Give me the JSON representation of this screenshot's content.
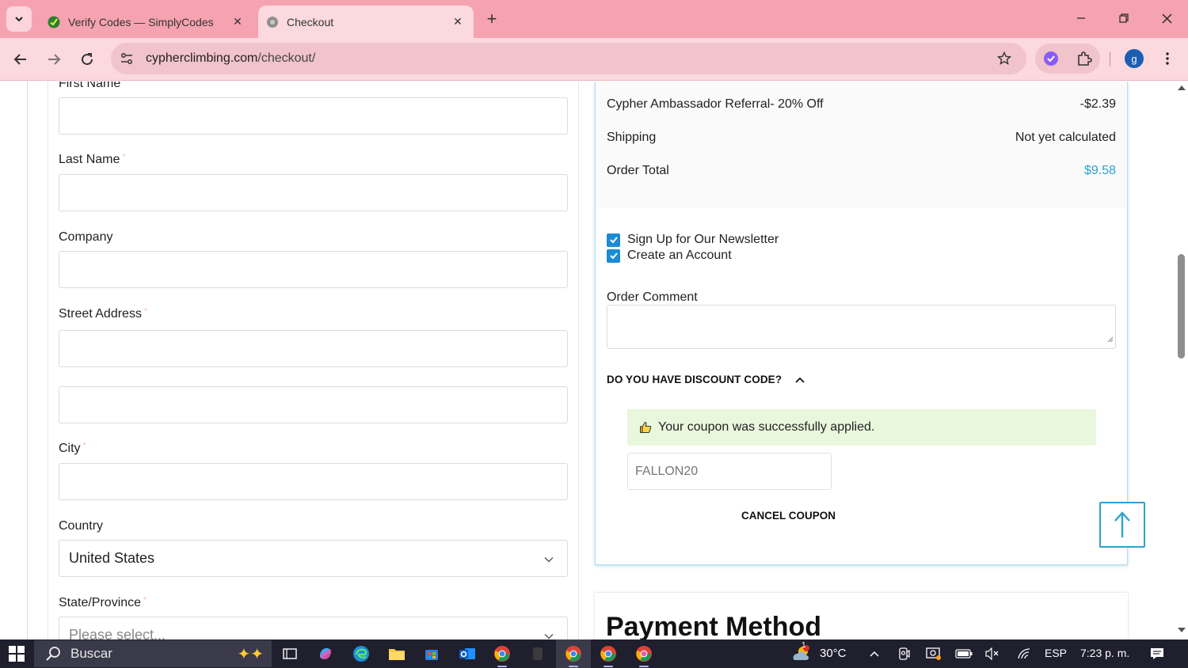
{
  "browser": {
    "tabs": [
      {
        "title": "Verify Codes — SimplyCodes",
        "active": false,
        "favicon": "simplycodes-logo-icon"
      },
      {
        "title": "Checkout",
        "active": true,
        "favicon": "globe-icon"
      }
    ],
    "url_host": "cypherclimbing.com",
    "url_path": "/checkout/",
    "profile_initial": "g",
    "theme_color": "#f5a3b0"
  },
  "billing": {
    "first_name_label": "First Name",
    "last_name_label": "Last Name",
    "company_label": "Company",
    "street_label": "Street Address",
    "city_label": "City",
    "country_label": "Country",
    "country_value": "United States",
    "state_label": "State/Province",
    "state_placeholder": "Please select...",
    "required_mark": "*"
  },
  "summary": {
    "discount_row": {
      "label": "Cypher Ambassador Referral- 20% Off",
      "value": "-$2.39"
    },
    "shipping_row": {
      "label": "Shipping",
      "value": "Not yet calculated"
    },
    "total_row": {
      "label": "Order Total",
      "value": "$9.58"
    },
    "newsletter_label": "Sign Up for Our Newsletter",
    "newsletter_checked": true,
    "create_account_label": "Create an Account",
    "create_account_checked": true,
    "order_comment_label": "Order Comment",
    "discount_toggle_label": "DO YOU HAVE DISCOUNT CODE?",
    "coupon_success": "Your coupon was successfully applied.",
    "coupon_code": "FALLON20",
    "cancel_coupon_label": "CANCEL COUPON",
    "accent_color": "#2ba3cf"
  },
  "payment": {
    "title": "Payment Method"
  },
  "taskbar": {
    "search_label": "Buscar",
    "weather": "30°C",
    "weather_badge": "1",
    "language": "ESP",
    "time": "7:23 p. m."
  }
}
